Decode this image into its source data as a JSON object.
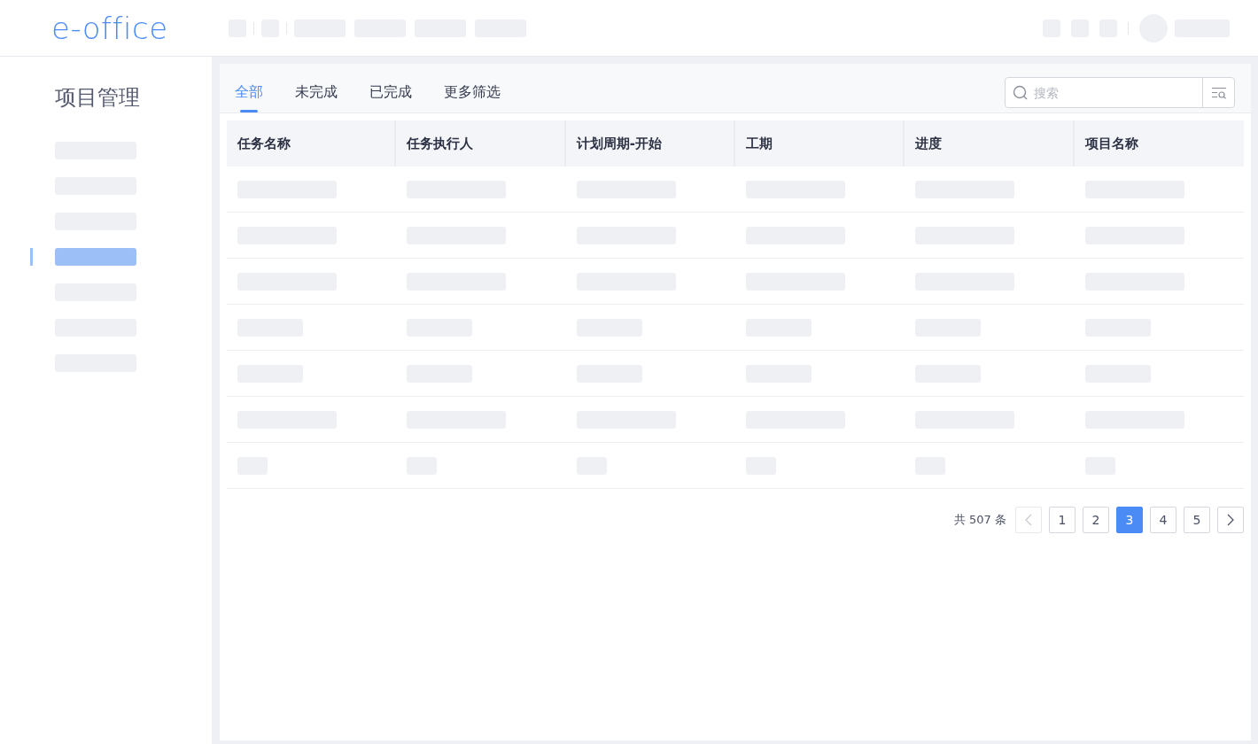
{
  "header": {
    "logo": "e-office"
  },
  "sidebar": {
    "title": "项目管理",
    "items": [
      {
        "selected": false
      },
      {
        "selected": false
      },
      {
        "selected": false
      },
      {
        "selected": true
      },
      {
        "selected": false
      },
      {
        "selected": false
      },
      {
        "selected": false
      }
    ]
  },
  "tabs": [
    {
      "label": "全部",
      "selected": true
    },
    {
      "label": "未完成",
      "selected": false
    },
    {
      "label": "已完成",
      "selected": false
    },
    {
      "label": "更多筛选",
      "selected": false
    }
  ],
  "search": {
    "placeholder": "搜索"
  },
  "table": {
    "columns": [
      "任务名称",
      "任务执行人",
      "计划周期-开始",
      "工期",
      "进度",
      "项目名称"
    ],
    "rows": [
      {
        "kind": "long"
      },
      {
        "kind": "long"
      },
      {
        "kind": "long"
      },
      {
        "kind": "medium"
      },
      {
        "kind": "medium"
      },
      {
        "kind": "long"
      },
      {
        "kind": "short"
      }
    ]
  },
  "pagination": {
    "total": "共 507 条",
    "prev_disabled": true,
    "pages": [
      {
        "label": "1",
        "selected": false
      },
      {
        "label": "2",
        "selected": false
      },
      {
        "label": "3",
        "selected": true
      },
      {
        "label": "4",
        "selected": false
      },
      {
        "label": "5",
        "selected": false
      }
    ]
  }
}
